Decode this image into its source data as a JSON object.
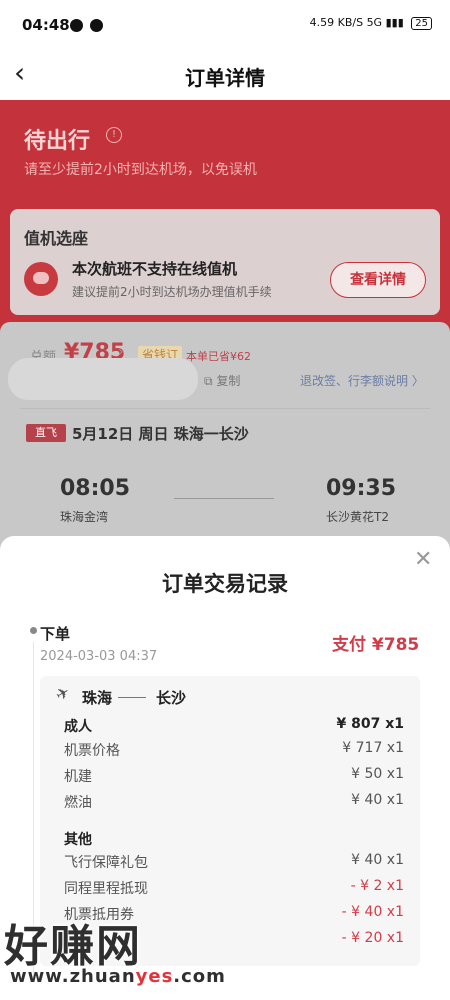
{
  "status_bar": {
    "time": "04:48",
    "net_speed": "4.59 KB/S",
    "signal": "5G",
    "battery": "25"
  },
  "header": {
    "title": "订单详情"
  },
  "trip_status": {
    "title": "待出行",
    "subtitle": "请至少提前2小时到达机场，以免误机"
  },
  "checkin": {
    "title": "值机选座",
    "main": "本次航班不支持在线值机",
    "sub": "建议提前2小时到达机场办理值机手续",
    "button": "查看详情"
  },
  "order_summary": {
    "total_label": "总额",
    "total_price": "¥785",
    "save_tag": "省钱订",
    "save_note": "本单已省¥62",
    "copy": "复制",
    "rules_link": "退改签、行李额说明 〉"
  },
  "flight": {
    "tag": "直飞",
    "route": "5月12日 周日 珠海一长沙",
    "dep_time": "08:05",
    "dep_airport": "珠海金湾",
    "arr_time": "09:35",
    "arr_airport": "长沙黄花T2"
  },
  "sheet": {
    "title": "订单交易记录",
    "event": "下单",
    "date": "2024-03-03 04:37",
    "pay": "支付 ¥785",
    "from": "珠海",
    "to": "长沙",
    "rows": [
      {
        "label": "成人",
        "value": "¥ 807 x1",
        "style": "strong"
      },
      {
        "label": "机票价格",
        "value": "¥ 717 x1",
        "style": "normal"
      },
      {
        "label": "机建",
        "value": "¥ 50 x1",
        "style": "normal"
      },
      {
        "label": "燃油",
        "value": "¥ 40 x1",
        "style": "normal"
      },
      {
        "label": "其他",
        "value": "",
        "style": "strong"
      },
      {
        "label": "飞行保障礼包",
        "value": "¥ 40 x1",
        "style": "normal"
      },
      {
        "label": "同程里程抵现",
        "value": "- ¥ 2 x1",
        "style": "neg"
      },
      {
        "label": "机票抵用券",
        "value": "- ¥ 40 x1",
        "style": "neg"
      },
      {
        "label": "",
        "value": "- ¥ 20 x1",
        "style": "neg"
      }
    ]
  },
  "watermark": {
    "big": "好赚网",
    "url_a": "www.zhuan",
    "url_b": "yes",
    "url_c": ".com"
  }
}
